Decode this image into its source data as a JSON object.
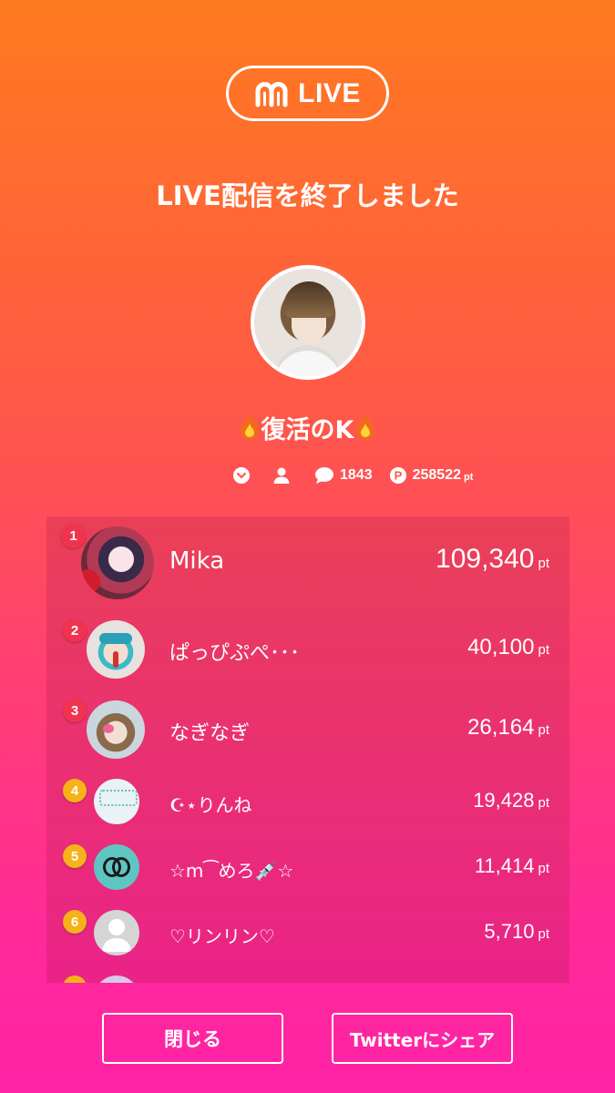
{
  "header": {
    "logo_text": "LIVE",
    "title": "LIVE配信を終了しました"
  },
  "host": {
    "name": "復活のK"
  },
  "stats": {
    "comments": "1843",
    "points": "258522",
    "points_unit": "pt"
  },
  "ranking": {
    "unit": "pt",
    "items": [
      {
        "rank": "1",
        "name": "Mika",
        "score": "109,340"
      },
      {
        "rank": "2",
        "name": "ぱっぴぷぺ･･･",
        "score": "40,100"
      },
      {
        "rank": "3",
        "name": "なぎなぎ",
        "score": "26,164"
      },
      {
        "rank": "4",
        "name": "☪︎⋆りんね",
        "score": "19,428"
      },
      {
        "rank": "5",
        "name": "☆m⁀めろ💉☆",
        "score": "11,414"
      },
      {
        "rank": "6",
        "name": "♡リンリン♡",
        "score": "5,710"
      }
    ]
  },
  "actions": {
    "close_label": "閉じる",
    "share_label": "Twitterにシェア"
  },
  "colors": {
    "gold": "#f7b21a",
    "red": "#f0344f",
    "bg_top": "#ff7a1f",
    "bg_bottom": "#ff22a6"
  }
}
